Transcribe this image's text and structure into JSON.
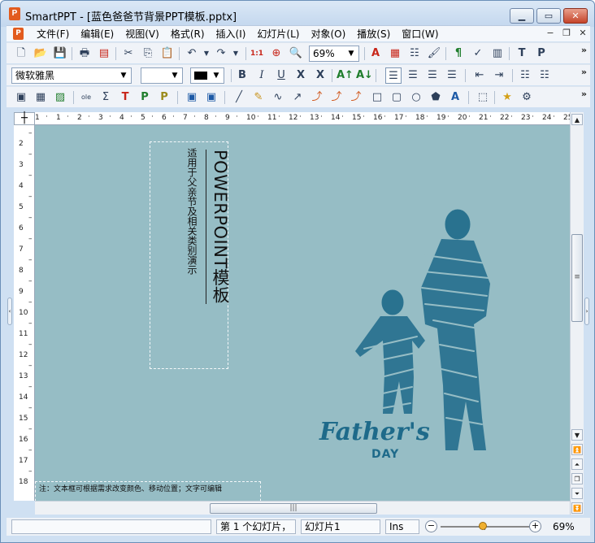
{
  "window": {
    "app_name": "SmartPPT",
    "title": "SmartPPT - [蓝色爸爸节背景PPT模板.pptx]",
    "app_icon_letter": "P"
  },
  "menu": {
    "items": [
      "文件(F)",
      "编辑(E)",
      "视图(V)",
      "格式(R)",
      "插入(I)",
      "幻灯片(L)",
      "对象(O)",
      "播放(S)",
      "窗口(W)"
    ]
  },
  "toolbar1": {
    "zoom_value": "69%",
    "overflow": "»"
  },
  "toolbar2": {
    "font_name": "微软雅黑",
    "font_size": "",
    "overflow": "»"
  },
  "toolbar3": {
    "overflow": "»"
  },
  "ruler": {
    "horizontal": [
      "1",
      "1",
      "2",
      "3",
      "4",
      "5",
      "6",
      "7",
      "8",
      "9",
      "10",
      "11",
      "12",
      "13",
      "14",
      "15",
      "16",
      "17",
      "18",
      "19",
      "20",
      "21",
      "22",
      "23",
      "24",
      "25"
    ],
    "vertical": [
      "2",
      "3",
      "4",
      "5",
      "6",
      "7",
      "8",
      "9",
      "10",
      "11",
      "12",
      "13",
      "14",
      "15",
      "16",
      "17",
      "18"
    ]
  },
  "slide": {
    "title_vertical": "POWERPOINT模板",
    "subtitle_vertical": "适用于父亲节及相关类别演示",
    "note": "注：文本框可根据需求改变颜色、移动位置；文字可编辑",
    "logo_script": "Father's",
    "logo_day": "DAY",
    "colors": {
      "background": "#96bdc5",
      "silhouette": "#1e6a8a"
    }
  },
  "status": {
    "slide_index": "第 1 个幻灯片，",
    "slide_name": "幻灯片1",
    "mode": "Ins",
    "zoom": "69%",
    "zoom_level": 0.45
  }
}
